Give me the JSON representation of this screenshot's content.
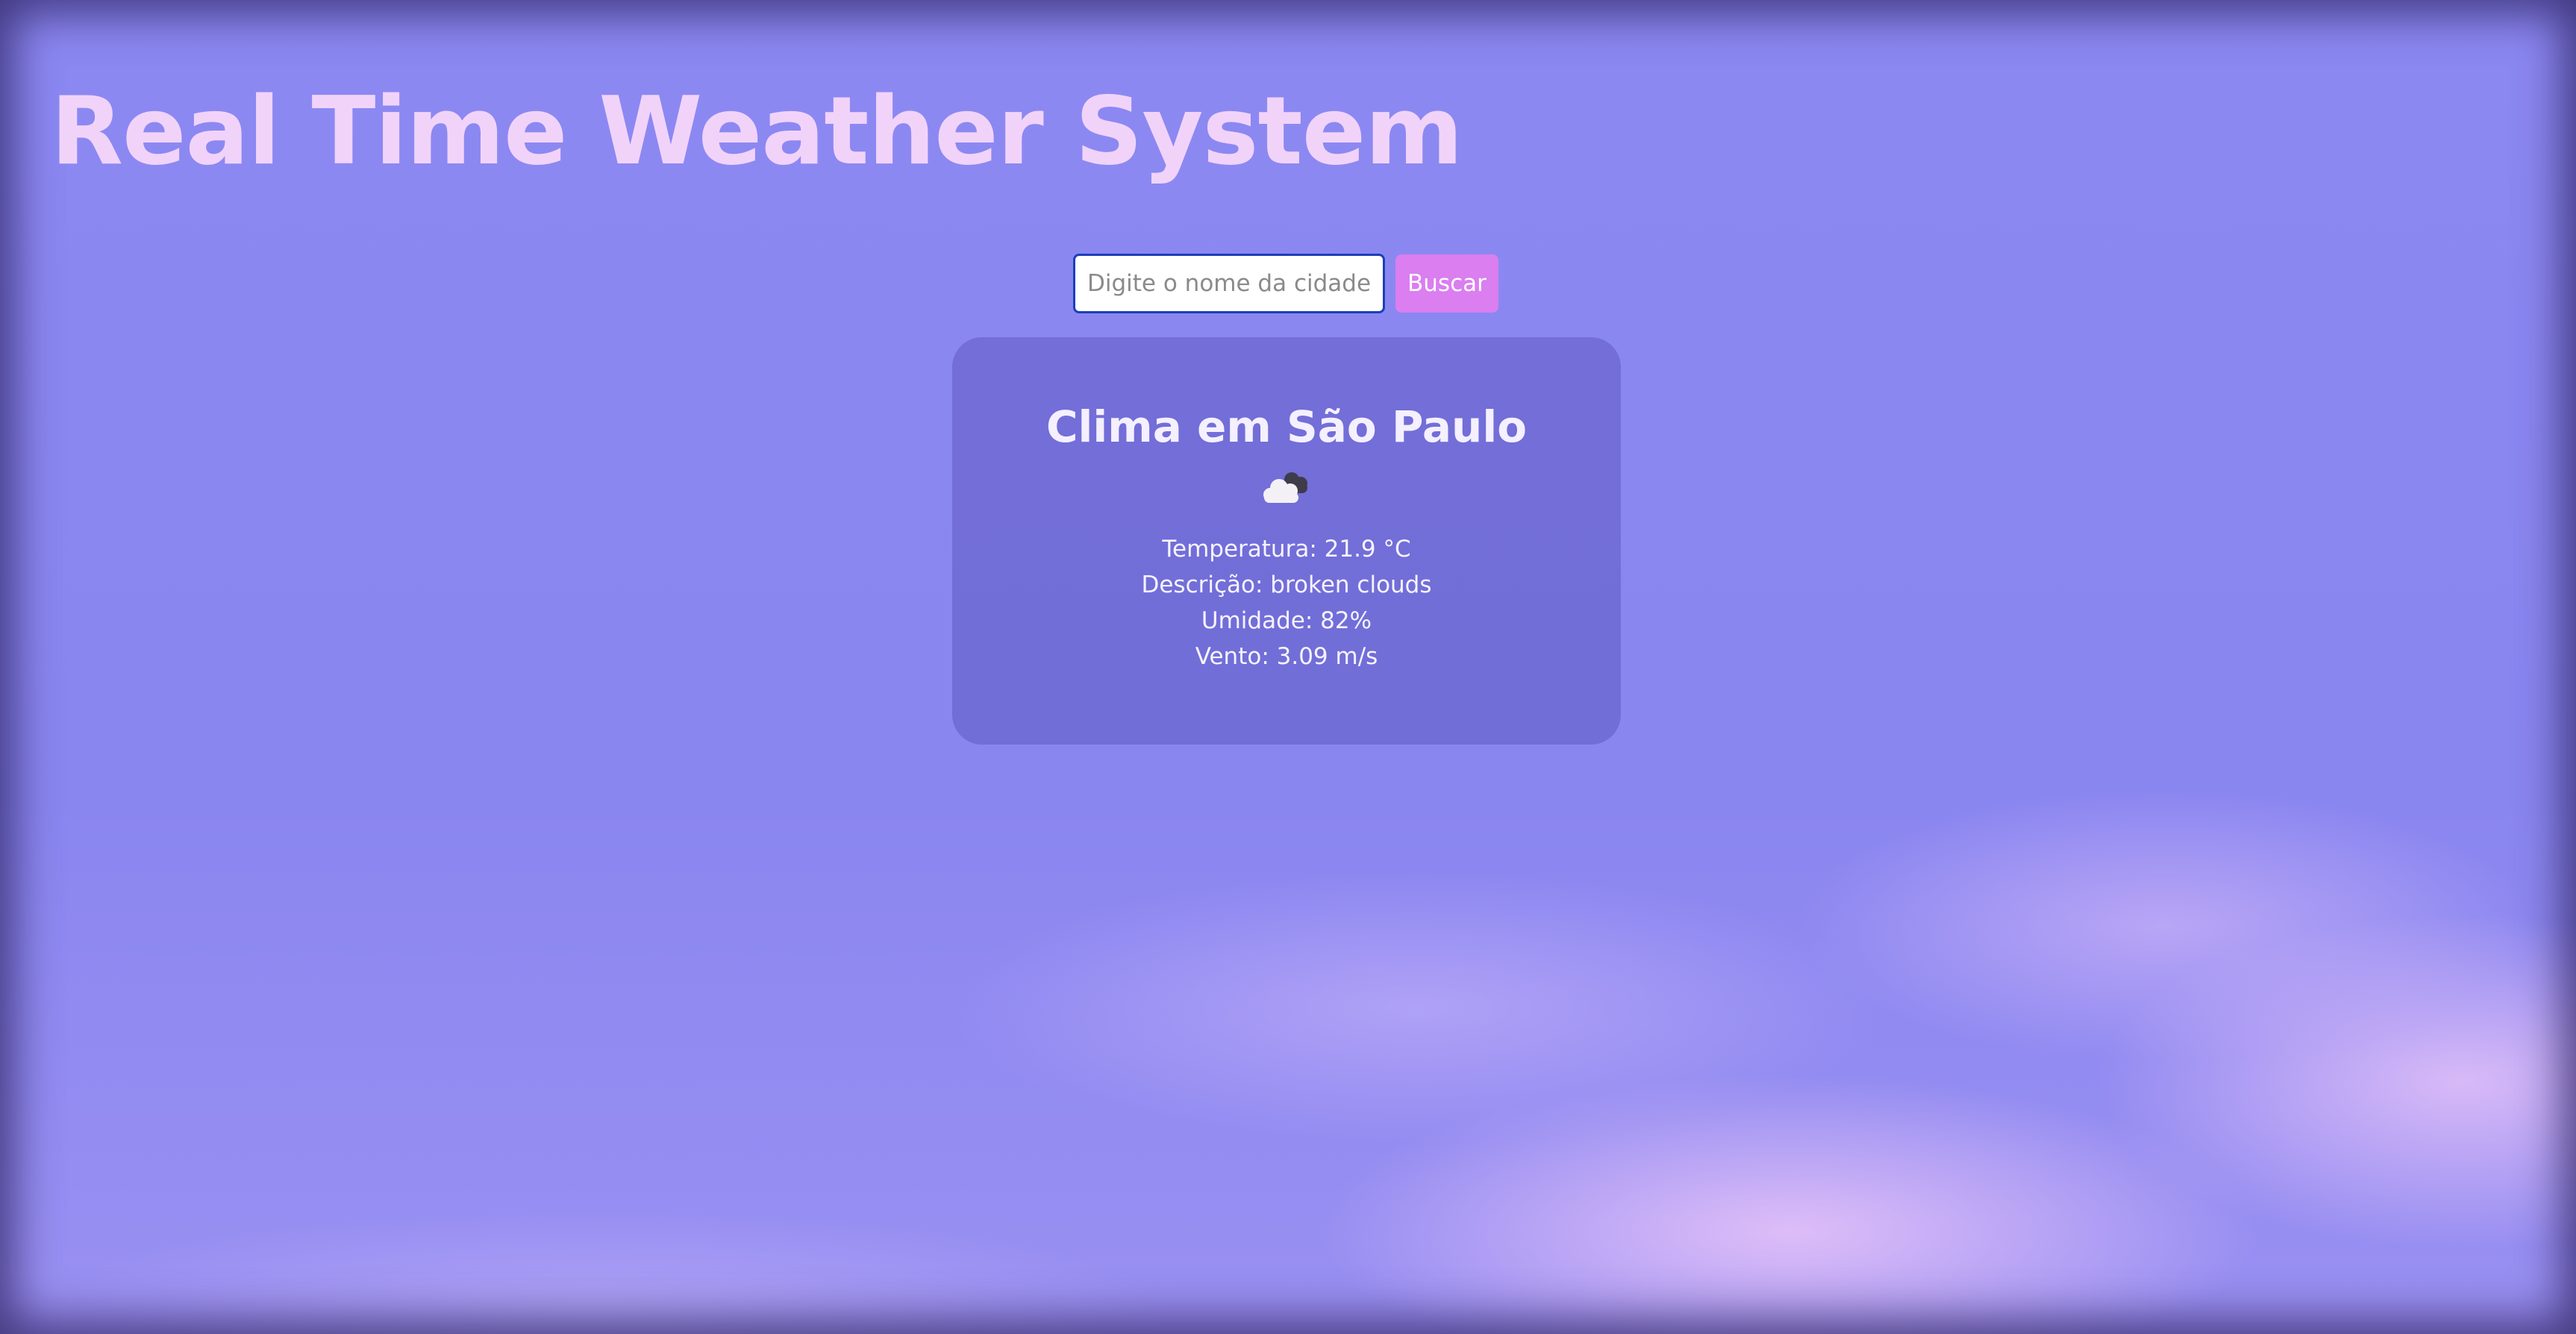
{
  "header": {
    "title": "Real Time Weather System"
  },
  "search": {
    "placeholder": "Digite o nome da cidade",
    "value": "",
    "button_label": "Buscar"
  },
  "weather": {
    "title": "Clima em São Paulo",
    "icon": "broken-clouds-icon",
    "temperature": "Temperatura: 21.9 °C",
    "description": "Descrição: broken clouds",
    "humidity": "Umidade: 82%",
    "wind": "Vento: 3.09 m/s"
  },
  "colors": {
    "background": "#8b87f1",
    "title": "#f1d3fa",
    "button": "#da7ef0",
    "card": "#6a64cf",
    "input_border": "#1c3fb8"
  }
}
